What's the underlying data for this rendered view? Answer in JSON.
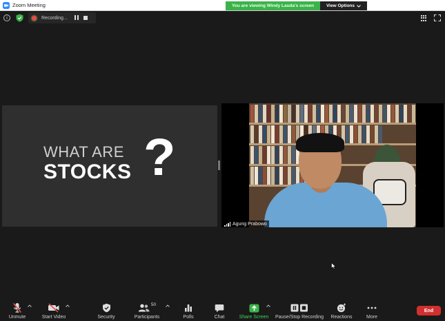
{
  "window": {
    "title": "Zoom Meeting"
  },
  "banner": {
    "message": "You are viewing Windy Lauda's screen",
    "view_options": "View Options"
  },
  "top_controls": {
    "info_glyph": "i",
    "recording_label": "Recording..."
  },
  "shared_content": {
    "line1": "WHAT ARE",
    "line2": "STOCKS",
    "mark": "?"
  },
  "video": {
    "participant_name": "Agung Prabowo"
  },
  "toolbar": {
    "unmute": "Unmute",
    "start_video": "Start Video",
    "security": "Security",
    "participants": "Participants",
    "participants_count": "50",
    "polls": "Polls",
    "chat": "Chat",
    "share_screen": "Share Screen",
    "pause_stop_recording": "Pause/Stop Recording",
    "reactions": "Reactions",
    "more": "More",
    "end": "End"
  },
  "colors": {
    "accent_green": "#3bb34a",
    "recording_red": "#e34b4b",
    "end_red": "#d0302f",
    "background": "#1a1a1a"
  },
  "icons": {
    "app": "zoom-camera-icon",
    "info": "info-icon",
    "security": "shield-check-icon",
    "gallery": "grid-icon",
    "fullscreen": "fullscreen-icon",
    "mute": "microphone-muted-icon",
    "video": "video-off-icon",
    "participants": "people-icon",
    "polls": "bar-chart-icon",
    "chat": "chat-bubble-icon",
    "share": "share-arrow-icon",
    "record": "pause-stop-icon",
    "reactions": "smiley-icon",
    "more": "ellipsis-icon"
  }
}
